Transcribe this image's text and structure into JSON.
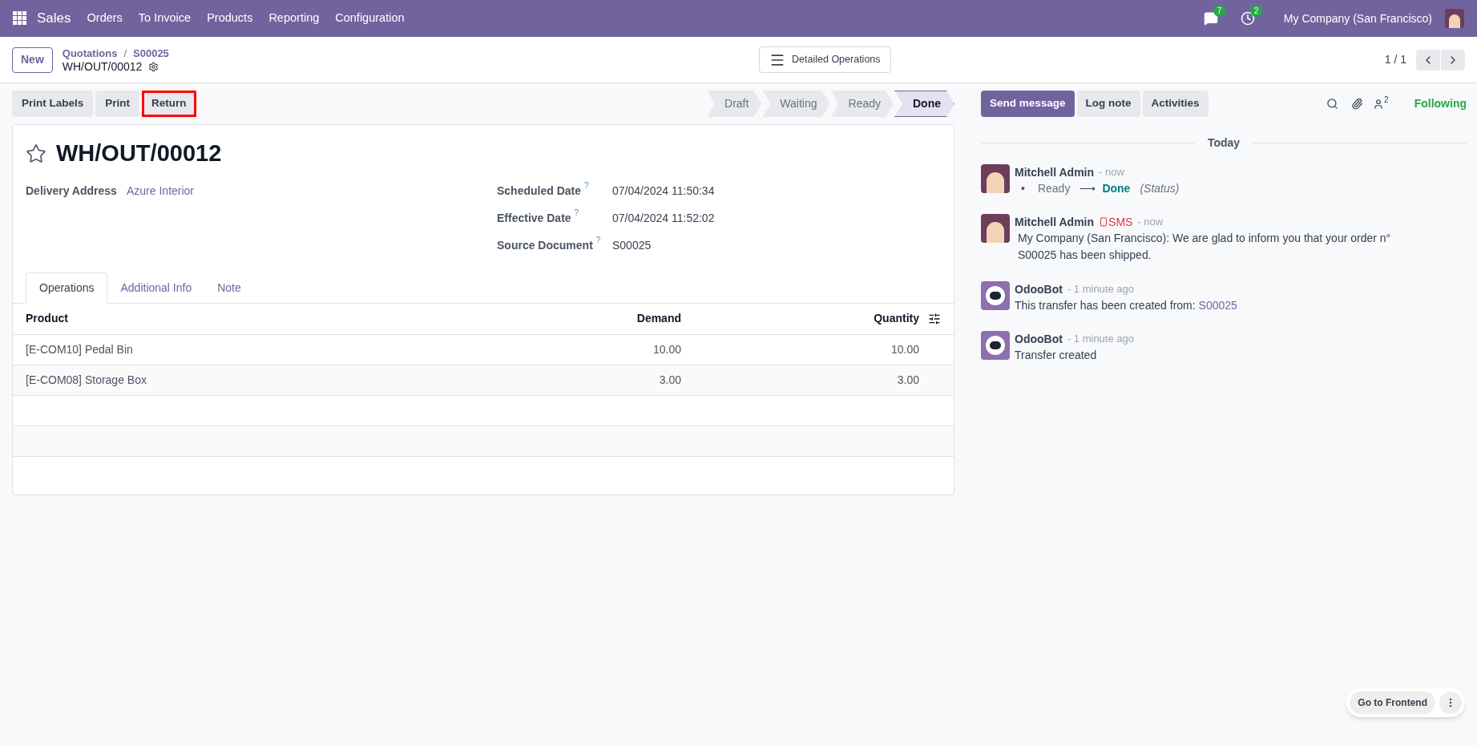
{
  "navbar": {
    "app": "Sales",
    "menu": [
      "Orders",
      "To Invoice",
      "Products",
      "Reporting",
      "Configuration"
    ],
    "messages_count": "7",
    "activities_count": "2",
    "company": "My Company (San Francisco)"
  },
  "control_panel": {
    "new_button": "New",
    "breadcrumbs": [
      "Quotations",
      "S00025"
    ],
    "breadcrumb_separator": "/",
    "record": "WH/OUT/00012",
    "center_button": "Detailed Operations",
    "pager": "1 / 1"
  },
  "actions": [
    {
      "label": "Print Labels",
      "highlighted": false
    },
    {
      "label": "Print",
      "highlighted": false
    },
    {
      "label": "Return",
      "highlighted": true
    }
  ],
  "statusbar": [
    {
      "label": "Draft",
      "selected": false
    },
    {
      "label": "Waiting",
      "selected": false
    },
    {
      "label": "Ready",
      "selected": false
    },
    {
      "label": "Done",
      "selected": true
    }
  ],
  "form": {
    "title": "WH/OUT/00012",
    "starred": false,
    "left_fields": [
      {
        "label": "Delivery Address",
        "value": "Azure Interior",
        "link": true
      }
    ],
    "right_fields": [
      {
        "label": "Scheduled Date",
        "help": "?",
        "value": "07/04/2024 11:50:34"
      },
      {
        "label": "Effective Date",
        "help": "?",
        "value": "07/04/2024 11:52:02"
      },
      {
        "label": "Source Document",
        "help": "?",
        "value": "S00025"
      }
    ],
    "tabs": [
      {
        "label": "Operations",
        "selected": true
      },
      {
        "label": "Additional Info",
        "selected": false
      },
      {
        "label": "Note",
        "selected": false
      }
    ],
    "table": {
      "columns": [
        "Product",
        "Demand",
        "Quantity"
      ],
      "rows": [
        [
          "[E-COM10] Pedal Bin",
          "10.00",
          "10.00"
        ],
        [
          "[E-COM08] Storage Box",
          "3.00",
          "3.00"
        ]
      ]
    }
  },
  "chatter": {
    "buttons": [
      {
        "label": "Send message",
        "selected": true
      },
      {
        "label": "Log note",
        "selected": false
      },
      {
        "label": "Activities",
        "selected": false
      }
    ],
    "followers_count": "2",
    "following": "Following",
    "date_separator": "Today",
    "messages": [
      {
        "kind": "tracking",
        "author": "Mitchell Admin",
        "bot": false,
        "time": "- now",
        "bullet": "•",
        "old": "Ready",
        "arrow": "⟶",
        "new": "Done",
        "field": "(Status)"
      },
      {
        "kind": "sms",
        "author": "Mitchell Admin",
        "bot": false,
        "sms": "SMS",
        "time": "- now",
        "body": "My Company (San Francisco): We are glad to inform you that your order n° S00025 has been shipped."
      },
      {
        "kind": "link",
        "author": "OdooBot",
        "bot": true,
        "time": "- 1 minute ago",
        "body": "This transfer has been created from:",
        "link": "S00025"
      },
      {
        "kind": "plain",
        "author": "OdooBot",
        "bot": true,
        "time": "- 1 minute ago",
        "body": "Transfer created"
      }
    ]
  },
  "floating": {
    "button": "Go to Frontend"
  }
}
